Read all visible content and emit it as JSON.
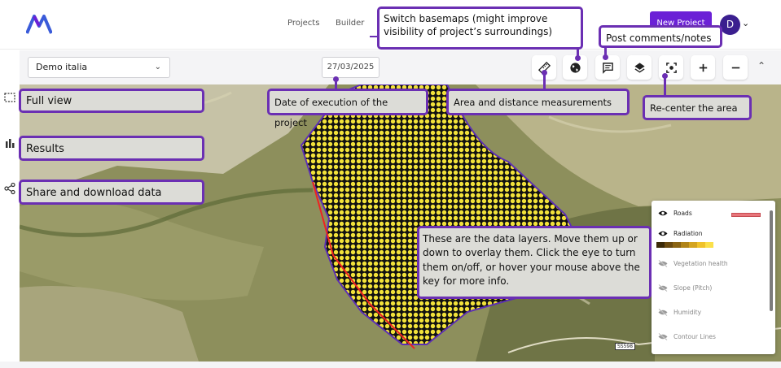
{
  "nav": {
    "links": [
      "Projects",
      "Builder"
    ],
    "new_project_label": "New Project",
    "avatar_letter": "D"
  },
  "toolbar": {
    "project_select_value": "Demo italia",
    "date_value": "27/03/2025",
    "tools": [
      "ruler-icon",
      "globe-icon",
      "comment-icon",
      "layers-icon",
      "recenter-icon",
      "zoom-in-icon",
      "zoom-out-icon"
    ]
  },
  "map": {
    "road_sign": "SS598"
  },
  "legend": {
    "layers": [
      {
        "label": "Roads",
        "visible": true
      },
      {
        "label": "Radiation",
        "visible": true
      },
      {
        "label": "Vegetation health",
        "visible": false
      },
      {
        "label": "Slope (Pitch)",
        "visible": false
      },
      {
        "label": "Humidity",
        "visible": false
      },
      {
        "label": "Contour Lines",
        "visible": false
      }
    ],
    "roads_color": "#e8767b",
    "radiation_scale": [
      "#3b2a08",
      "#6a4a10",
      "#8a6414",
      "#b08418",
      "#d4a420",
      "#f0c22a",
      "#fbe04a"
    ]
  },
  "callouts": {
    "basemaps": "Switch basemaps (might improve visibility of project’s surroundings)",
    "comments": "Post comments/notes",
    "full_view": "Full view",
    "date_exec": "Date of execution of the project",
    "measure": "Area and distance measurements",
    "recenter": "Re-center the area",
    "results": "Results",
    "share": "Share and download data",
    "layers_info": "These are the data layers. Move them up or down to overlay them. Click the eye to turn them on/off, or hover your mouse above the key for more info."
  },
  "colors": {
    "accent": "#6b2fb3",
    "brand": "#6b21d6"
  }
}
